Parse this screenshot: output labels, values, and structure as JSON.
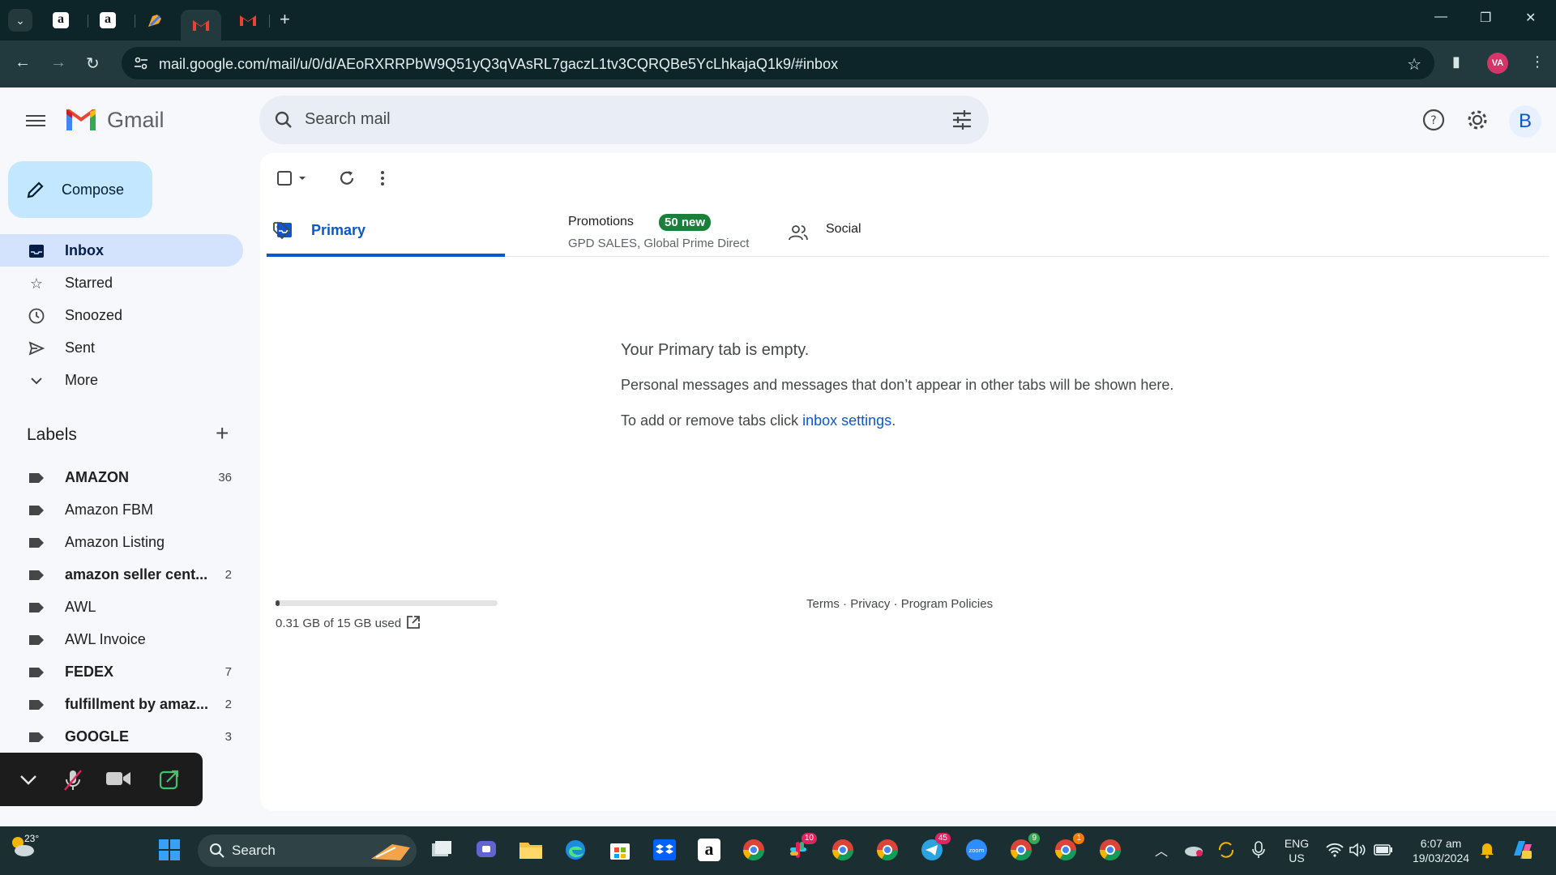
{
  "browser": {
    "url": "mail.google.com/mail/u/0/d/AEoRXRRPbW9Q51yQ3qVAsRL7gaczL1tv3CQRQBe5YcLhkajaQ1k9/#inbox",
    "profile_initials": "VA"
  },
  "gmail": {
    "logo_text": "Gmail",
    "search_placeholder": "Search mail",
    "account_initial": "B"
  },
  "sidebar": {
    "compose_label": "Compose",
    "nav": [
      {
        "label": "Inbox",
        "icon": "inbox-icon",
        "active": true
      },
      {
        "label": "Starred",
        "icon": "star-icon"
      },
      {
        "label": "Snoozed",
        "icon": "clock-icon"
      },
      {
        "label": "Sent",
        "icon": "send-icon"
      },
      {
        "label": "More",
        "icon": "chevron-down-icon"
      }
    ],
    "labels_heading": "Labels",
    "labels": [
      {
        "name": "AMAZON",
        "count": "36",
        "bold": true
      },
      {
        "name": "Amazon FBM",
        "count": "",
        "bold": false
      },
      {
        "name": "Amazon Listing",
        "count": "",
        "bold": false
      },
      {
        "name": "amazon seller cent...",
        "count": "2",
        "bold": true
      },
      {
        "name": "AWL",
        "count": "",
        "bold": false
      },
      {
        "name": "AWL Invoice",
        "count": "",
        "bold": false
      },
      {
        "name": "FEDEX",
        "count": "7",
        "bold": true
      },
      {
        "name": "fulfillment by amaz...",
        "count": "2",
        "bold": true
      },
      {
        "name": "GOOGLE",
        "count": "3",
        "bold": true
      }
    ]
  },
  "tabs": {
    "primary": "Primary",
    "promotions": "Promotions",
    "promotions_badge": "50 new",
    "promotions_senders": "GPD SALES, Global Prime Direct",
    "social": "Social"
  },
  "empty_state": {
    "title": "Your Primary tab is empty.",
    "line1": "Personal messages and messages that don’t appear in other tabs will be shown here.",
    "line2_prefix": "To add or remove tabs click ",
    "line2_link": "inbox settings",
    "line2_suffix": "."
  },
  "storage": {
    "used_text": "0.31 GB of 15 GB used",
    "used_fraction": 0.02
  },
  "footer": {
    "terms": "Terms",
    "privacy": "Privacy",
    "policies": "Program Policies",
    "separator": " · "
  },
  "taskbar": {
    "weather": "23°",
    "search": "Search",
    "lang_top": "ENG",
    "lang_bottom": "US",
    "time": "6:07 am",
    "date": "19/03/2024",
    "slack_badge": "10",
    "telegram_badge": "45",
    "chrome_badge_a": "9",
    "chrome_badge_b": "1"
  },
  "colors": {
    "accent": "#0b57d0",
    "compose_bg": "#c2e7ff",
    "active_nav_bg": "#d3e3fd",
    "promo_badge": "#188038"
  }
}
